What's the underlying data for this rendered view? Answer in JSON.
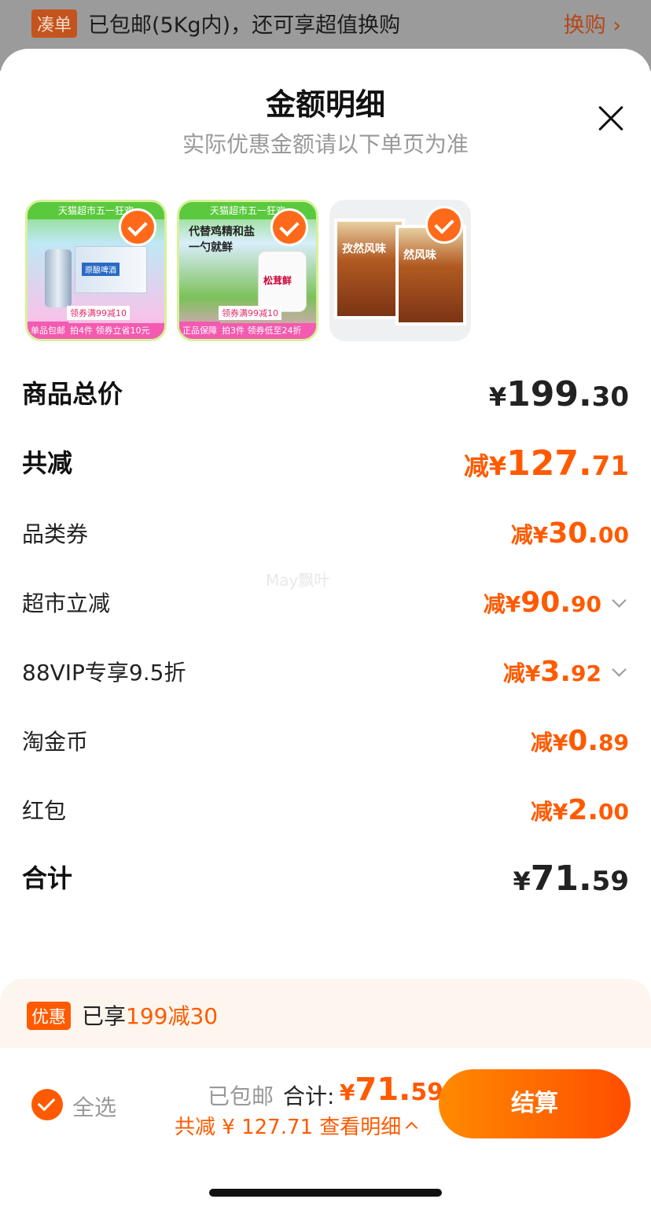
{
  "topbar": {
    "tag": "凑单",
    "message": "已包邮(5Kg内)，还可享超值换购",
    "action": "换购 ›"
  },
  "sheet": {
    "title": "金额明细",
    "subtitle": "实际优惠金额请以下单页为准"
  },
  "products": [
    {
      "banner": "天猫超市五一狂欢",
      "badge": "单品包邮",
      "promo1": "领券满99减10",
      "promo2": "拍4件 领券立省10元",
      "label": "原酿啤酒"
    },
    {
      "banner": "天猫超市五一狂欢",
      "badge": "正品保障",
      "promo1": "领券满99减10",
      "promo2": "拍3件 领券低至24折",
      "headline": "代替鸡精和盐\n一勺就鲜",
      "label": "松茸鲜"
    },
    {
      "label1": "孜然风味",
      "label2": "然风味"
    }
  ],
  "rows": {
    "subtotal": {
      "label": "商品总价",
      "pre": "¥",
      "int": "199.",
      "dec": "30"
    },
    "total_discount": {
      "label": "共减",
      "pre": "减¥",
      "int": "127.",
      "dec": "71"
    },
    "category_coupon": {
      "label": "品类券",
      "pre": "减¥",
      "int": "30.",
      "dec": "00"
    },
    "market_discount": {
      "label": "超市立减",
      "pre": "减¥",
      "int": "90.",
      "dec": "90"
    },
    "vip": {
      "label": "88VIP专享9.5折",
      "pre": "减¥",
      "int": "3.",
      "dec": "92"
    },
    "gold_coin": {
      "label": "淘金币",
      "pre": "减¥",
      "int": "0.",
      "dec": "89"
    },
    "red_packet": {
      "label": "红包",
      "pre": "减¥",
      "int": "2.",
      "dec": "00"
    },
    "total": {
      "label": "合计",
      "pre": "¥",
      "int": "71.",
      "dec": "59"
    }
  },
  "watermark": "May飘叶",
  "discount_strip": {
    "tag": "优惠",
    "prefix": "已享",
    "highlight": "199减30"
  },
  "checkout": {
    "select_all": "全选",
    "free_shipping": "已包邮",
    "total_label": "合计:",
    "total_pre": "¥",
    "total_int": "71.",
    "total_dec": "59",
    "saved_line": "共减 ¥ 127.71  查看明细",
    "pay_button": "结算"
  },
  "colors": {
    "accent": "#ff5a00",
    "text": "#222222",
    "muted": "#999999"
  }
}
